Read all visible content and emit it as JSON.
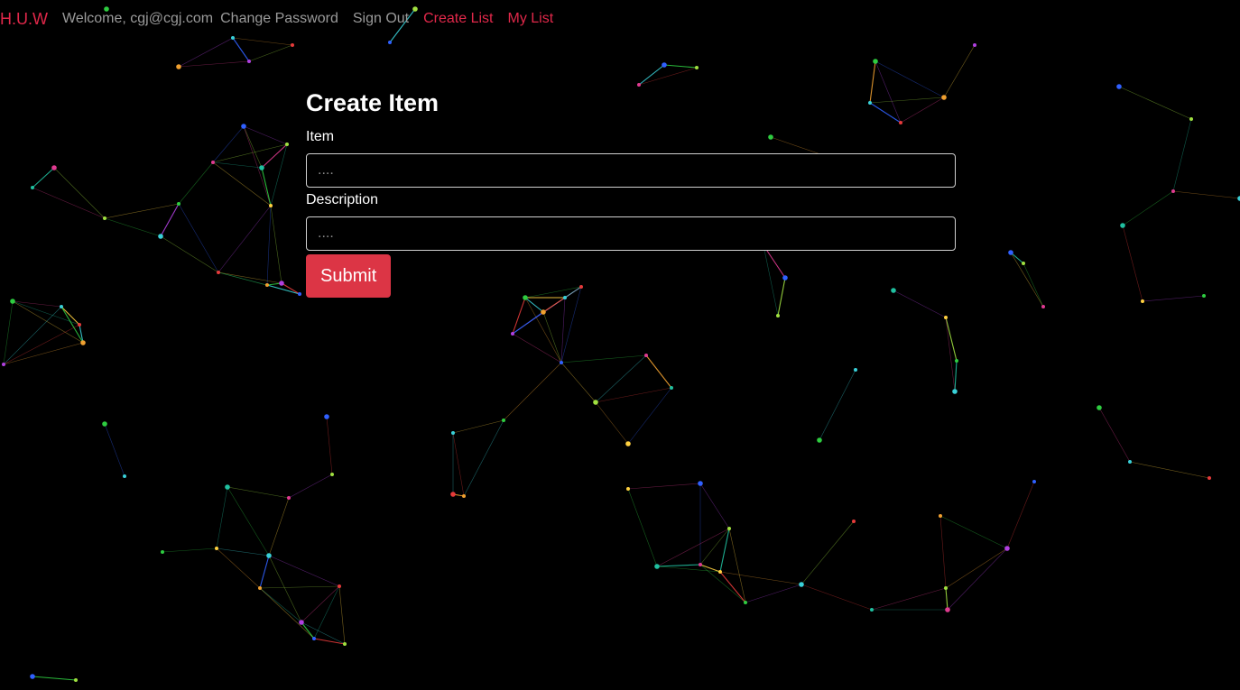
{
  "nav": {
    "brand": "H.U.W",
    "welcome": "Welcome, cgj@cgj.com",
    "change_password": "Change Password",
    "sign_out": "Sign Out",
    "create_list": "Create List",
    "my_list": "My List"
  },
  "form": {
    "title": "Create Item",
    "item_label": "Item",
    "item_placeholder": "....",
    "item_value": "",
    "description_label": "Description",
    "description_placeholder": "....",
    "description_value": "",
    "submit_label": "Submit"
  },
  "colors": {
    "background": "#000000",
    "accent": "#e0284a",
    "nav_text": "#9a9a9a",
    "submit_bg": "#dc3545"
  }
}
